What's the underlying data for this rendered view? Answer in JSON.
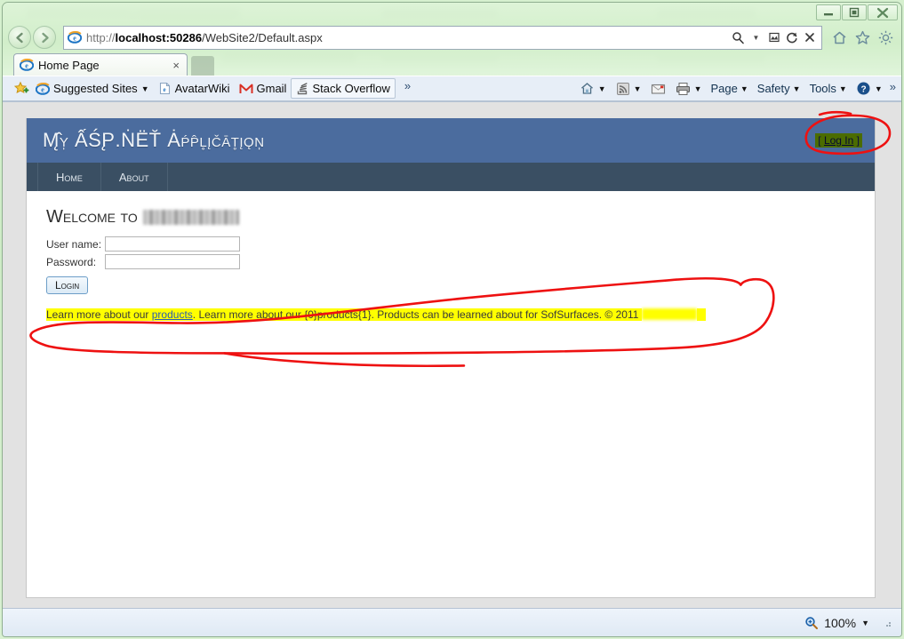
{
  "window": {
    "controls": {
      "minimize": "minimize-button",
      "maximize": "maximize-button",
      "close": "close-button"
    }
  },
  "address_bar": {
    "url_protocol": "http://",
    "url_host": "localhost:50286",
    "url_path": "/WebSite2/Default.aspx",
    "url_full": "http://localhost:50286/WebSite2/Default.aspx",
    "icons": [
      "search-icon",
      "dropdown-icon",
      "compatibility-view-icon",
      "refresh-icon",
      "stop-icon"
    ],
    "toolbar_icons": [
      "home-icon",
      "favorites-star-icon",
      "tools-gear-icon"
    ]
  },
  "tabs": {
    "items": [
      {
        "label": "Home Page",
        "favicon": "ie-favicon",
        "close": "×"
      }
    ],
    "new_tab_label": ""
  },
  "favorites_bar": {
    "star_icon": "add-favorites-icon",
    "items": [
      {
        "label": "Suggested Sites",
        "icon": "ie-icon",
        "has_chevron": true,
        "boxed": false
      },
      {
        "label": "AvatarWiki",
        "icon": "page-icon",
        "has_chevron": false,
        "boxed": false
      },
      {
        "label": "Gmail",
        "icon": "gmail-icon",
        "has_chevron": false,
        "boxed": false
      },
      {
        "label": "Stack Overflow",
        "icon": "stackoverflow-icon",
        "has_chevron": false,
        "boxed": true
      }
    ],
    "overflow_left": "»",
    "overflow_right": "»"
  },
  "command_bar": {
    "items": [
      {
        "label": "",
        "icon": "home-icon",
        "has_chevron": true
      },
      {
        "label": "",
        "icon": "rss-feed-icon",
        "has_chevron": true
      },
      {
        "label": "",
        "icon": "read-mail-icon",
        "has_chevron": false
      },
      {
        "label": "",
        "icon": "print-icon",
        "has_chevron": true
      },
      {
        "label": "Page",
        "icon": "",
        "has_chevron": true
      },
      {
        "label": "Safety",
        "icon": "",
        "has_chevron": true
      },
      {
        "label": "Tools",
        "icon": "",
        "has_chevron": true
      },
      {
        "label": "",
        "icon": "help-icon",
        "has_chevron": true
      }
    ]
  },
  "page": {
    "site_title": "M̨̂y̩ ẤŚP̨.ṄËT̆ Ȧṕp̂l̥įčāt̥įǫn̩",
    "site_title_plain": "My ASP.NET Application",
    "login_link": "[ Log In ]",
    "login_link_text": "Log In",
    "nav": [
      {
        "label": "Home",
        "label_plain": "Home"
      },
      {
        "label": "About",
        "label_plain": "About"
      }
    ],
    "welcome_heading": "Welcome to",
    "welcome_redacted": true,
    "form": {
      "username_label": "User name:",
      "username_value": "",
      "password_label": "Password:",
      "password_value": "",
      "login_button": "Login"
    },
    "footer_text_parts": {
      "before_link": "Learn more about our ",
      "link": "products",
      "after_link": ". Learn more about our {0}products{1}. Products can be learned about for SofSurfaces. © 2011 ",
      "redacted_tail": true
    },
    "footer_text_full": "Learn more about our products. Learn more about our {0}products{1}. Products can be learned about for SofSurfaces. © 2011",
    "highlight_color": "#ffff00",
    "header_color": "#4b6c9e",
    "nav_color": "#3a4f63",
    "annotation_color": "#ee1111"
  },
  "status_bar": {
    "zoom_level": "100%",
    "zoom_icon": "zoom-magnifier-icon",
    "zoom_chevron": "▼"
  },
  "annotations": [
    {
      "name": "login-link-circle",
      "shape": "ellipse"
    },
    {
      "name": "footer-text-circle",
      "shape": "ellipse"
    }
  ]
}
